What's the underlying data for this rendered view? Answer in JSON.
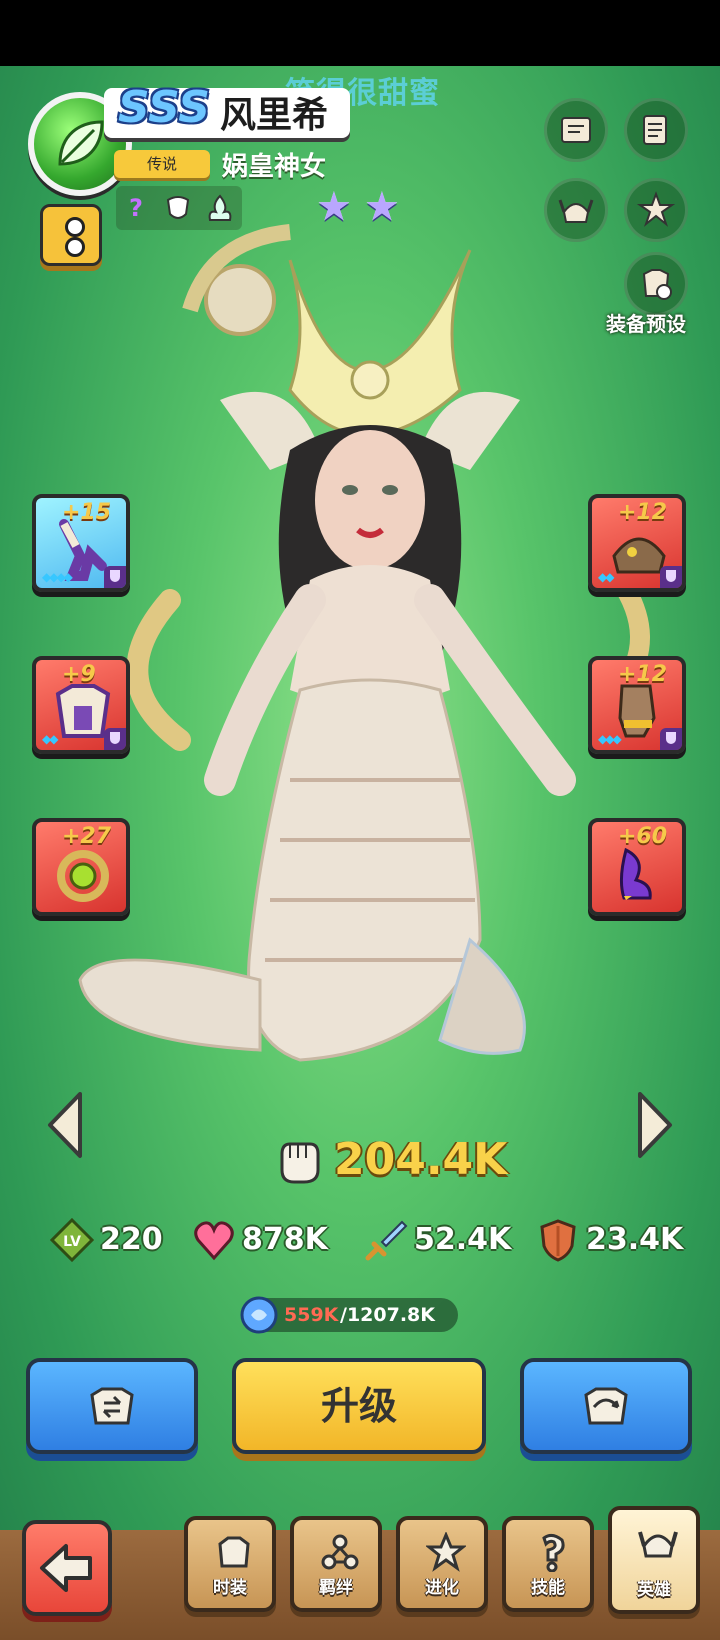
{
  "watermark": "笑得很甜蜜",
  "hero": {
    "rank": "SSS",
    "name": "风里希",
    "rarity": "传说",
    "title": "娲皇神女",
    "stars": 2
  },
  "right_menu": {
    "preset_label": "装备预设"
  },
  "equipment": {
    "left": [
      {
        "level": "+15",
        "gems": "◆◆◆◆"
      },
      {
        "level": "+9",
        "gems": "◆◆"
      },
      {
        "level": "+27",
        "gems": ""
      }
    ],
    "right": [
      {
        "level": "+12",
        "gems": "◆◆"
      },
      {
        "level": "+12",
        "gems": "◆◆◆"
      },
      {
        "level": "+60",
        "gems": ""
      }
    ]
  },
  "power": "204.4K",
  "stats": {
    "level": "220",
    "hp": "878K",
    "attack": "52.4K",
    "defense": "23.4K"
  },
  "exp": {
    "current": "559K",
    "max": "/1207.8K",
    "progress": 0.463
  },
  "actions": {
    "upgrade_label": "升级"
  },
  "tabs": [
    {
      "label": "时装",
      "icon": "outfit-icon"
    },
    {
      "label": "羁绊",
      "icon": "bond-icon"
    },
    {
      "label": "进化",
      "icon": "evolve-icon"
    },
    {
      "label": "技能",
      "icon": "skill-icon"
    },
    {
      "label": "英雄",
      "icon": "hero-icon",
      "active": true
    }
  ],
  "colors": {
    "background": "#4fbb64",
    "power": "#f9d24a",
    "exp_current": "#ff6a53",
    "primary_button": "#f2b628",
    "secondary_button": "#2f7fe3"
  }
}
